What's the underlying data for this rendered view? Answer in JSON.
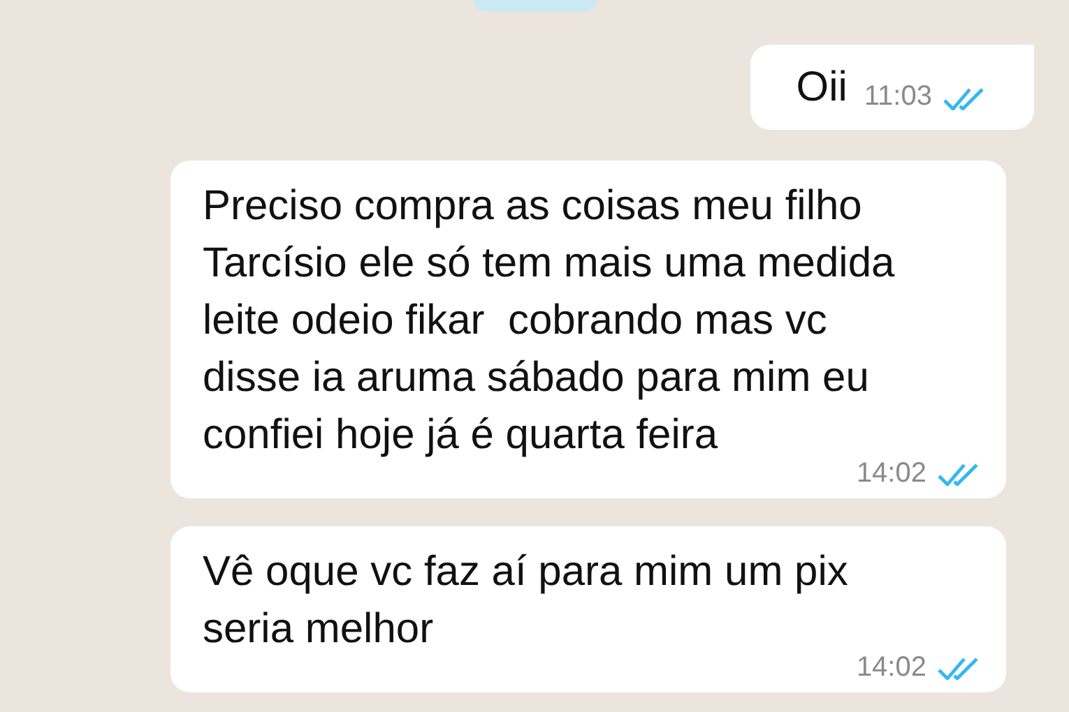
{
  "messages": [
    {
      "kind": "outgoing",
      "text": "Oii",
      "time": "11:03",
      "read": true
    },
    {
      "kind": "incoming",
      "text": "Preciso compra as coisas meu filho Tarcísio ele só tem mais uma medida leite odeio fikar  cobrando mas vc disse ia aruma sábado para mim eu confiei hoje já é quarta feira",
      "time": "14:02",
      "read": true
    },
    {
      "kind": "incoming",
      "text": "Vê oque vc faz aí para mim um pix seria melhor",
      "time": "14:02",
      "read": true
    }
  ]
}
